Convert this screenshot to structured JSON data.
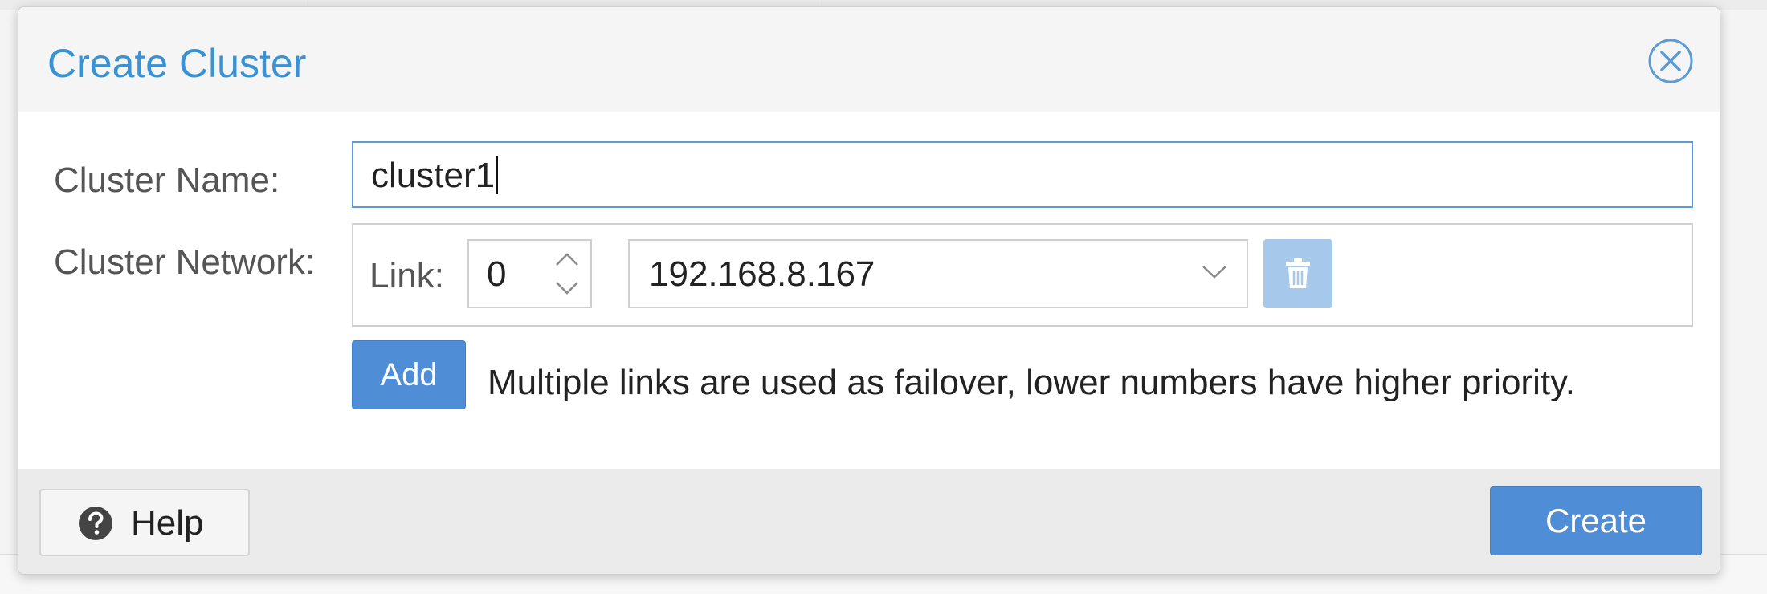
{
  "dialog": {
    "title": "Create Cluster",
    "accent_color": "#3892d4"
  },
  "form": {
    "cluster_name_label": "Cluster Name:",
    "cluster_name_value": "cluster1",
    "cluster_network_label": "Cluster Network:",
    "link_label": "Link:",
    "link_number": "0",
    "link_address": "192.168.8.167",
    "add_label": "Add",
    "hint": "Multiple links are used as failover, lower numbers have higher priority."
  },
  "footer": {
    "help_label": "Help",
    "create_label": "Create"
  },
  "icons": {
    "close": "close-circle-icon",
    "spinner_up": "chevron-up-icon",
    "spinner_down": "chevron-down-icon",
    "dropdown": "chevron-down-icon",
    "delete": "trash-icon",
    "help": "question-circle-icon"
  },
  "colors": {
    "primary_button": "#4f8ed6",
    "disabled_button": "#a6c8ea",
    "focus_border": "#5f9ad6"
  }
}
